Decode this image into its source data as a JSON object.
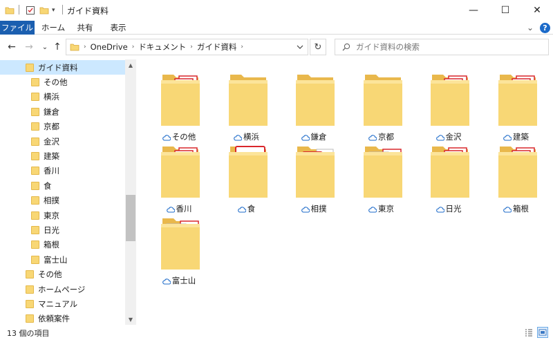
{
  "window": {
    "title": "ガイド資料",
    "minimize": "—",
    "maximize": "☐",
    "close": "✕"
  },
  "ribbon": {
    "tabs": [
      "ファイル",
      "ホーム",
      "共有",
      "表示"
    ],
    "expand": "⌄",
    "help": "?"
  },
  "nav": {
    "back": "←",
    "forward": "→",
    "recent": "⌄",
    "up": "↑",
    "breadcrumb": [
      "OneDrive",
      "ドキュメント",
      "ガイド資料"
    ],
    "refresh": "↻",
    "search_placeholder": "ガイド資料の検索"
  },
  "sidebar": {
    "items": [
      {
        "label": "ガイド資料"
      },
      {
        "label": "その他"
      },
      {
        "label": "横浜"
      },
      {
        "label": "鎌倉"
      },
      {
        "label": "京都"
      },
      {
        "label": "金沢"
      },
      {
        "label": "建築"
      },
      {
        "label": "香川"
      },
      {
        "label": "食"
      },
      {
        "label": "相撲"
      },
      {
        "label": "東京"
      },
      {
        "label": "日光"
      },
      {
        "label": "箱根"
      },
      {
        "label": "富士山"
      },
      {
        "label": "その他"
      },
      {
        "label": "ホームページ"
      },
      {
        "label": "マニュアル"
      },
      {
        "label": "依頼案件"
      }
    ],
    "selected_index": 0
  },
  "folders": [
    {
      "label": "その他",
      "icon": "pdf-folder"
    },
    {
      "label": "横浜",
      "icon": "empty-folder"
    },
    {
      "label": "鎌倉",
      "icon": "empty-folder"
    },
    {
      "label": "京都",
      "icon": "empty-folder"
    },
    {
      "label": "金沢",
      "icon": "pdf-folder"
    },
    {
      "label": "建築",
      "icon": "pdf-folder"
    },
    {
      "label": "香川",
      "icon": "pdf-folder"
    },
    {
      "label": "食",
      "icon": "pdf-large-folder"
    },
    {
      "label": "相撲",
      "icon": "pdf-doc-folder"
    },
    {
      "label": "東京",
      "icon": "image-pdf-folder"
    },
    {
      "label": "日光",
      "icon": "pdf-folder"
    },
    {
      "label": "箱根",
      "icon": "pdf-folder"
    },
    {
      "label": "富士山",
      "icon": "ppt-pdf-folder"
    }
  ],
  "pdf_badge": "PDF",
  "status": {
    "count": "13 個の項目"
  },
  "colors": {
    "accent": "#1b5fb0",
    "selected": "#cce8ff",
    "folder": "#f8d775",
    "pdf_red": "#d9262b",
    "cloud": "#1b6ac9"
  }
}
